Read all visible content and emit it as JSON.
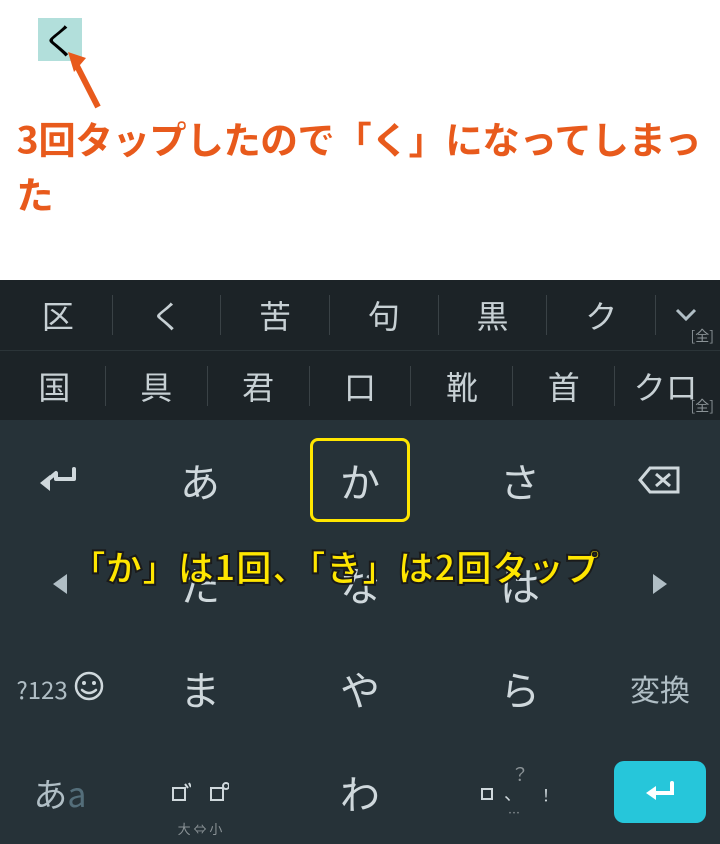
{
  "top": {
    "cursor_char": "く"
  },
  "annotations": {
    "text1": "3回タップしたので「く」になってしまった",
    "text2": "「か」は1回、「き」は2回タップ"
  },
  "suggestions": {
    "row1": [
      "区",
      "く",
      "苦",
      "句",
      "黒",
      "ク"
    ],
    "row2": [
      "国",
      "具",
      "君",
      "口",
      "靴",
      "首",
      "クロ"
    ],
    "badge": "[全]"
  },
  "keys": {
    "row1": {
      "left": "↰",
      "k1": "あ",
      "k2": "か",
      "k3": "さ",
      "right_icon": "backspace"
    },
    "row2": {
      "left_icon": "◀",
      "k1": "た",
      "k2": "な",
      "k3": "は",
      "right_icon": "▶"
    },
    "row3": {
      "left1": "?123",
      "k1": "ま",
      "k2": "や",
      "k3": "ら",
      "right": "変換"
    },
    "row4": {
      "left": "あa",
      "dakuten_top": "゛ ゜",
      "dakuten_label": "大 ⇔ 小",
      "k2": "わ",
      "punct_top": "？",
      "punct_mid": "。、！",
      "punct_bot": "…",
      "right_icon": "enter"
    }
  }
}
